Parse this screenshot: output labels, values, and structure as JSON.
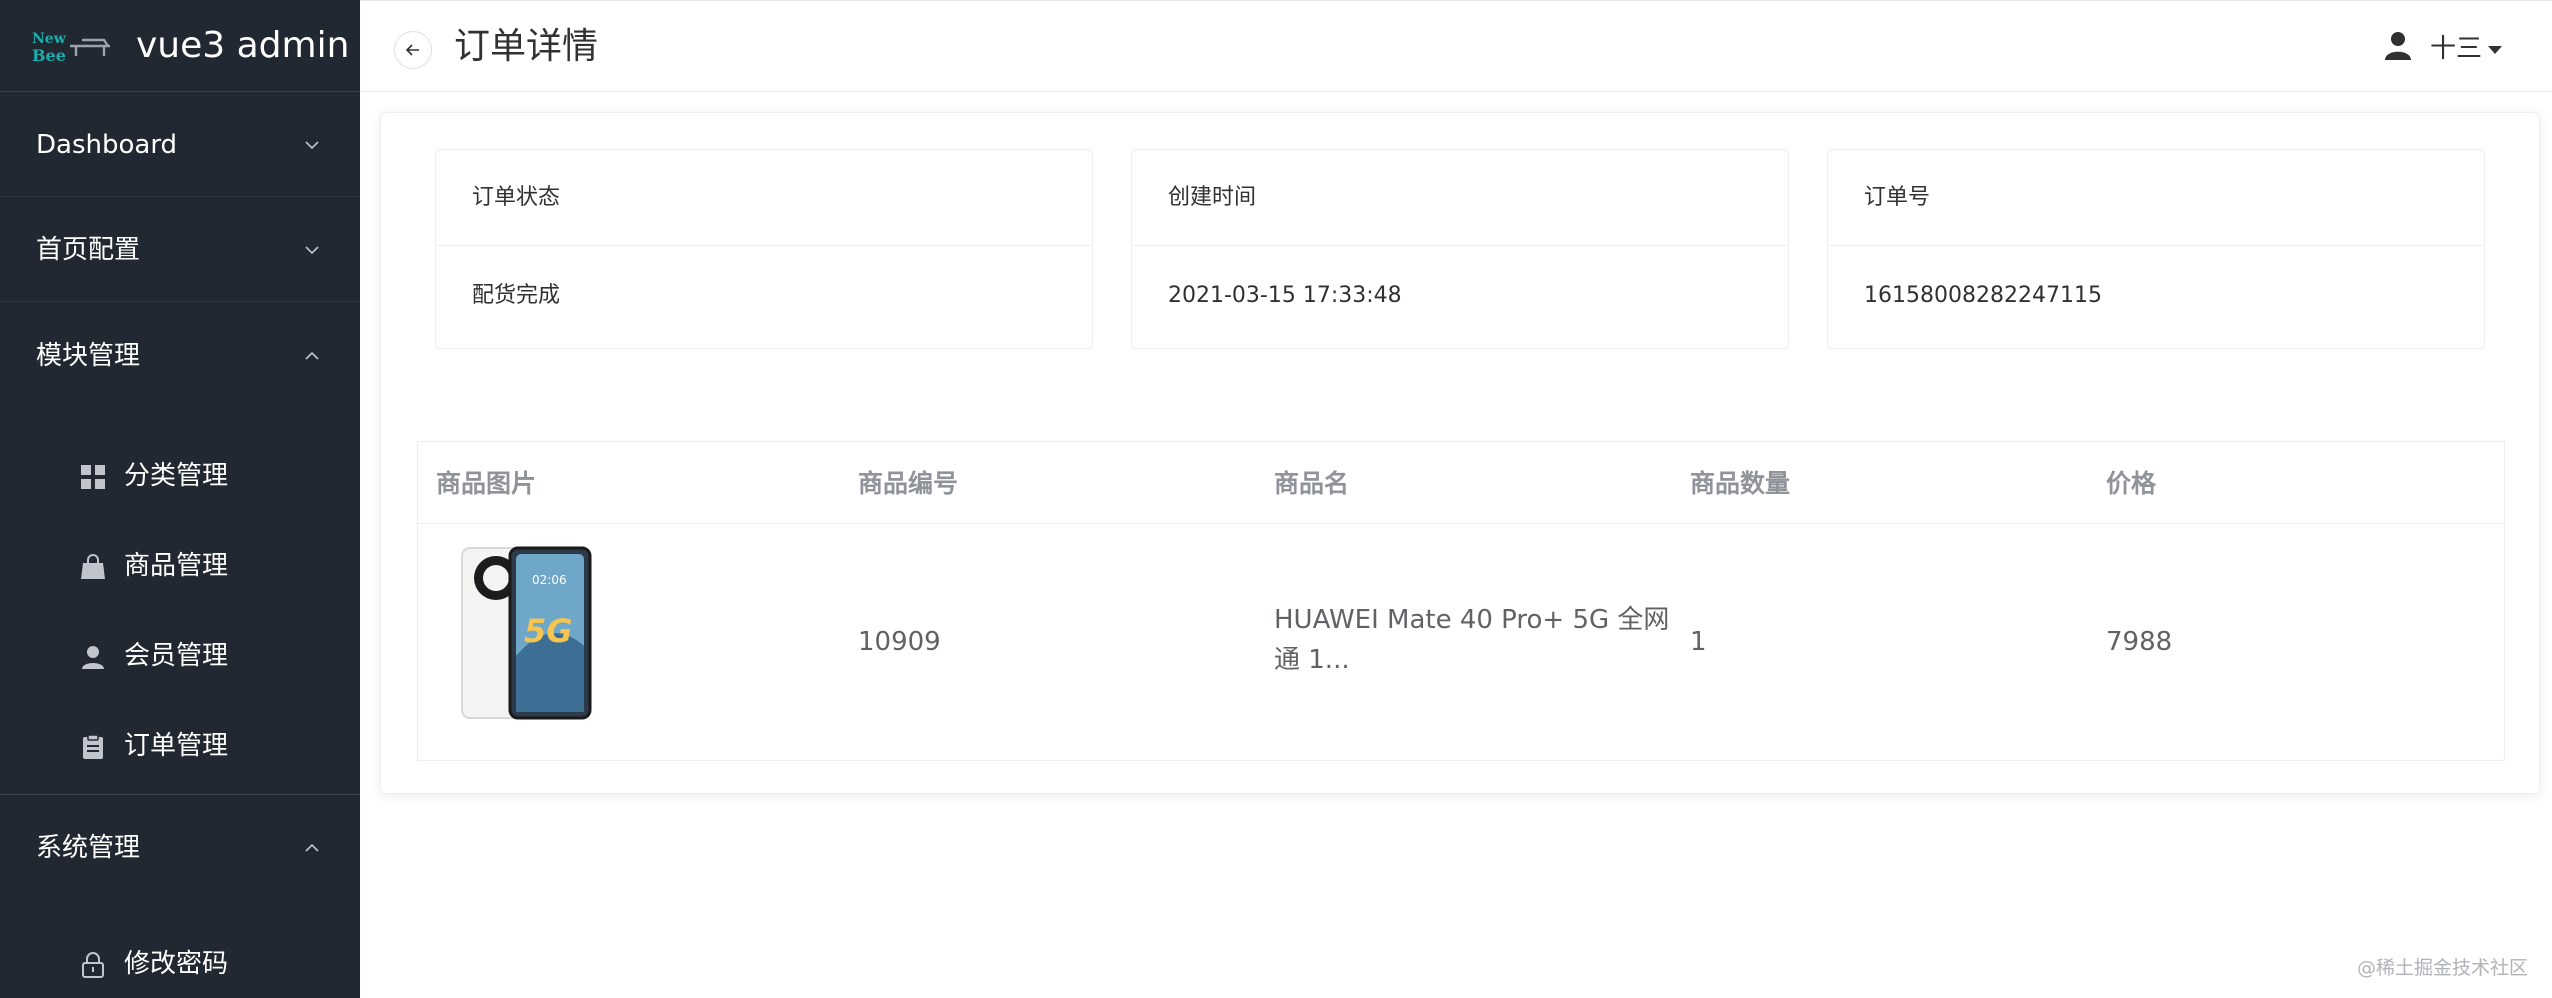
{
  "sidebar": {
    "logo_text_top": "New",
    "logo_text_bottom": "Bee",
    "app_title": "vue3 admin",
    "menu": [
      {
        "label": "Dashboard",
        "icon": "chevron-down-icon"
      },
      {
        "label": "首页配置",
        "icon": "chevron-down-icon"
      },
      {
        "label": "模块管理",
        "icon": "chevron-up-icon"
      },
      {
        "label": "系统管理",
        "icon": "chevron-up-icon"
      }
    ],
    "module_items": [
      {
        "label": "分类管理",
        "icon": "grid-icon"
      },
      {
        "label": "商品管理",
        "icon": "shopping-bag-icon"
      },
      {
        "label": "会员管理",
        "icon": "user-icon"
      },
      {
        "label": "订单管理",
        "icon": "clipboard-icon"
      }
    ],
    "system_items": [
      {
        "label": "修改密码",
        "icon": "lock-icon"
      }
    ]
  },
  "header": {
    "title": "订单详情",
    "user_name": "十三",
    "back_icon": "arrow-left-icon",
    "user_icon": "user-icon",
    "caret_icon": "caret-down-icon"
  },
  "order_info": [
    {
      "label": "订单状态",
      "value": "配货完成"
    },
    {
      "label": "创建时间",
      "value": "2021-03-15 17:33:48"
    },
    {
      "label": "订单号",
      "value": "16158008282247115"
    }
  ],
  "goods_table": {
    "columns": [
      "商品图片",
      "商品编号",
      "商品名",
      "商品数量",
      "价格"
    ],
    "rows": [
      {
        "image": "phone-product-image",
        "image_text": "5G",
        "image_time": "02:06",
        "goods_id": "10909",
        "goods_name_line1": "HUAWEI Mate 40 Pro+ 5G 全网",
        "goods_name_line2": "通 1...",
        "quantity": "1",
        "price": "7988"
      }
    ]
  },
  "watermark": "@稀土掘金技术社区",
  "colors": {
    "sidebar_bg": "#222832",
    "logo_accent": "#1baeae",
    "text_primary": "#303133",
    "text_secondary": "#606266",
    "table_header": "#909399",
    "border": "#ebeef5"
  }
}
